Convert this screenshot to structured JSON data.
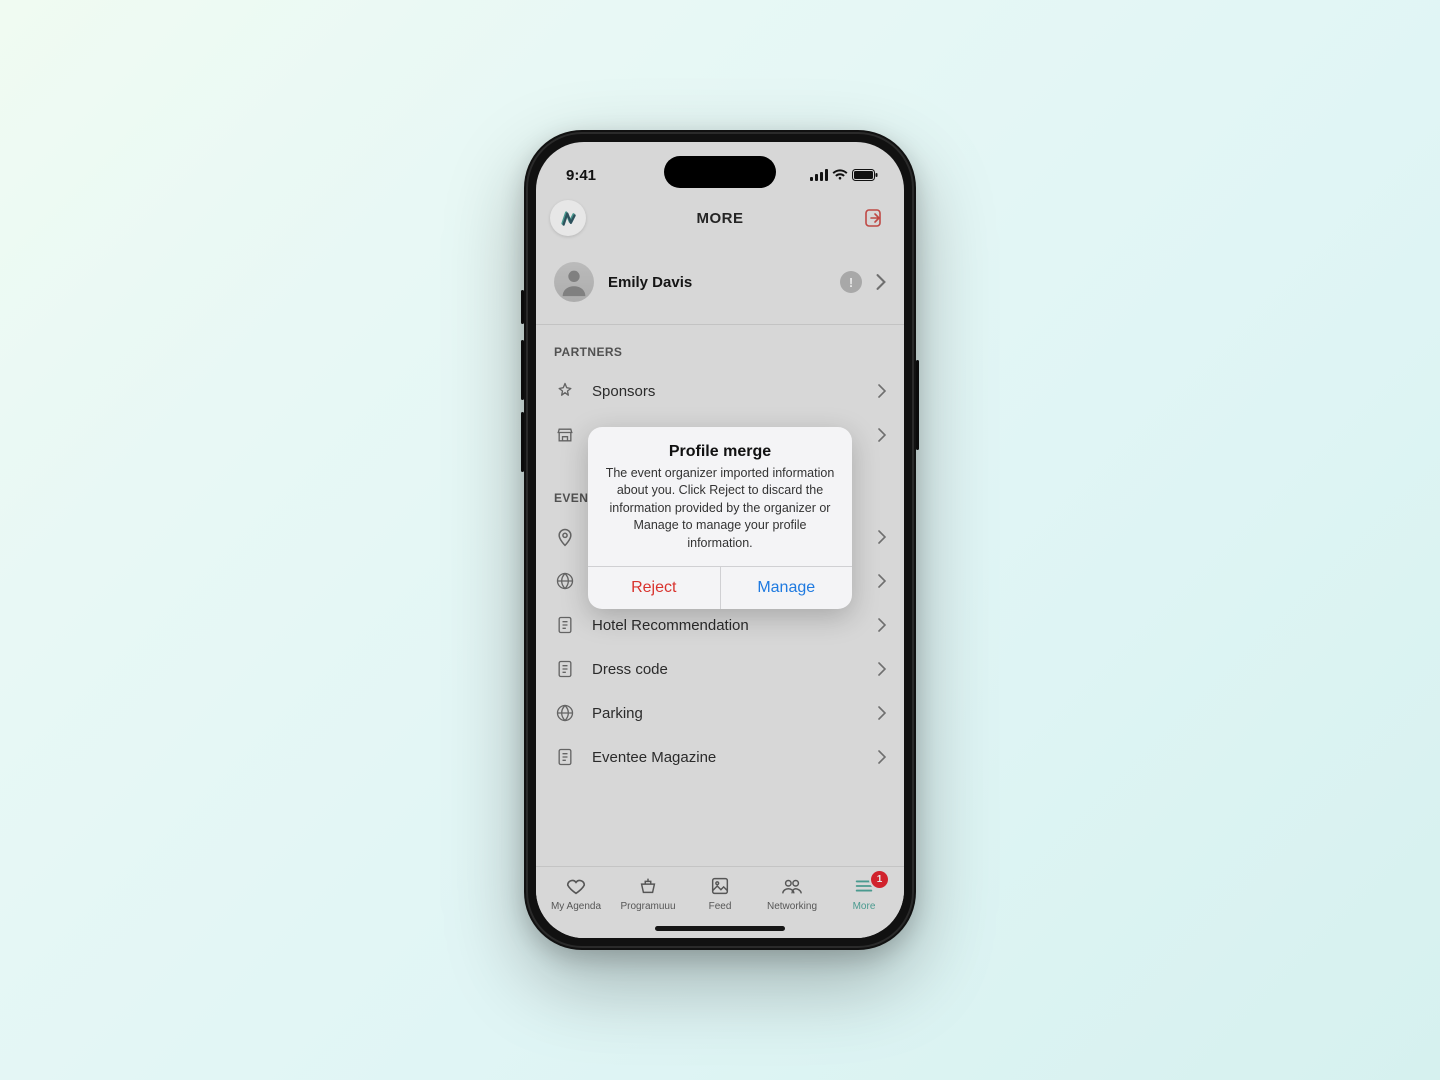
{
  "status": {
    "time": "9:41"
  },
  "header": {
    "title": "MORE"
  },
  "profile": {
    "name": "Emily Davis"
  },
  "sections": {
    "partners": {
      "title": "PARTNERS",
      "items": [
        {
          "label": "Sponsors"
        },
        {
          "label": ""
        }
      ]
    },
    "event": {
      "title": "EVEN",
      "items": [
        {
          "label": ""
        },
        {
          "label": ""
        },
        {
          "label": "Hotel Recommendation"
        },
        {
          "label": "Dress code"
        },
        {
          "label": "Parking"
        },
        {
          "label": "Eventee Magazine"
        }
      ]
    }
  },
  "tabs": [
    {
      "label": "My Agenda"
    },
    {
      "label": "Programuuu"
    },
    {
      "label": "Feed"
    },
    {
      "label": "Networking"
    },
    {
      "label": "More",
      "badge": "1"
    }
  ],
  "modal": {
    "title": "Profile merge",
    "message": "The event organizer imported information about you. Click Reject to discard the information provided by the organizer or Manage to manage your profile information.",
    "reject": "Reject",
    "manage": "Manage"
  }
}
